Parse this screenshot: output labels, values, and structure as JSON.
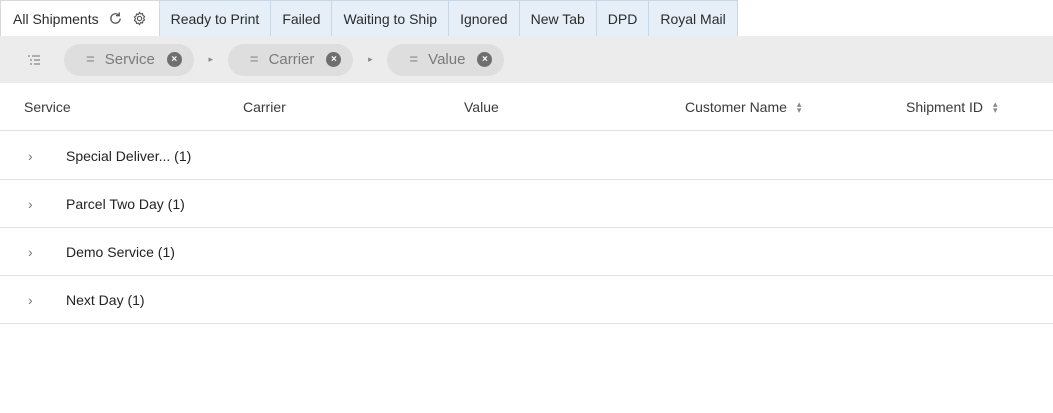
{
  "tabs": [
    {
      "label": "All Shipments",
      "name": "tab-all-shipments",
      "active": true
    },
    {
      "label": "Ready to Print",
      "name": "tab-ready-to-print"
    },
    {
      "label": "Failed",
      "name": "tab-failed"
    },
    {
      "label": "Waiting to Ship",
      "name": "tab-waiting-to-ship"
    },
    {
      "label": "Ignored",
      "name": "tab-ignored"
    },
    {
      "label": "New Tab",
      "name": "tab-new-tab"
    },
    {
      "label": "DPD",
      "name": "tab-dpd"
    },
    {
      "label": "Royal Mail",
      "name": "tab-royal-mail"
    }
  ],
  "tab_icons": [
    "refresh-icon",
    "settings-icon"
  ],
  "grouping": {
    "chips": [
      {
        "label": "Service"
      },
      {
        "label": "Carrier"
      },
      {
        "label": "Value"
      }
    ],
    "equals_symbol": "=",
    "remove_symbol": "×",
    "separator_symbol": "▸"
  },
  "table": {
    "columns": [
      {
        "label": "Service",
        "sortable": false
      },
      {
        "label": "Carrier",
        "sortable": false
      },
      {
        "label": "Value",
        "sortable": false
      },
      {
        "label": "Customer Name",
        "sortable": true
      },
      {
        "label": "Shipment ID",
        "sortable": true
      }
    ],
    "groups": [
      {
        "label": "Special Deliver... (1)"
      },
      {
        "label": "Parcel Two Day (1)"
      },
      {
        "label": "Demo Service (1)"
      },
      {
        "label": "Next Day (1)"
      }
    ]
  },
  "colors": {
    "tab_background": "#e6eef7",
    "toolbar_background": "#ececec",
    "chip_background": "#dedede"
  }
}
